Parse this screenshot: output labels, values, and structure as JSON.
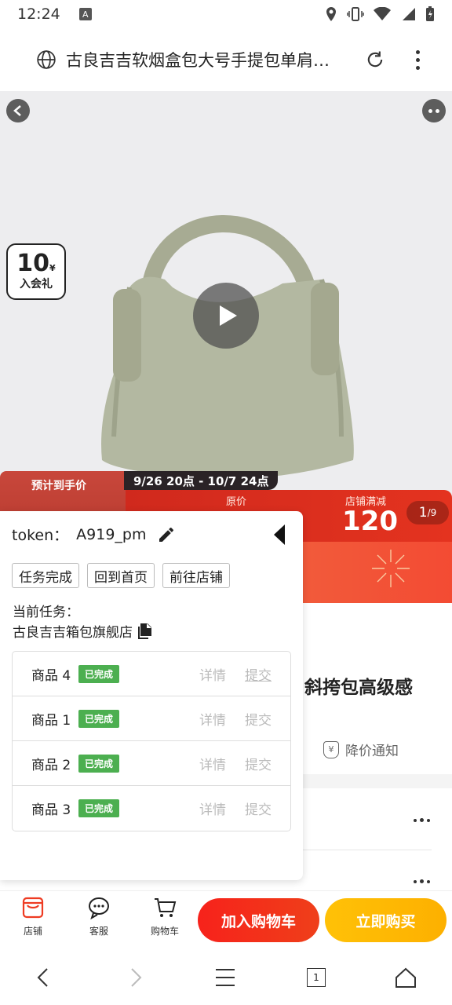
{
  "status_bar": {
    "time": "12:24",
    "notif_letter": "A"
  },
  "url_bar": {
    "title": "古良吉吉软烟盒包大号手提包单肩…"
  },
  "product": {
    "badge_value": "10",
    "badge_currency": "¥",
    "badge_text": "入会礼"
  },
  "promo": {
    "estimate_label": "预计到手价",
    "date_range": "9/26 20点 - 10/7 24点",
    "orig_label": "原价",
    "shop_discount_label": "店铺满减",
    "shop_discount_value": "120",
    "page_current": "1",
    "page_total": "/9"
  },
  "product_info": {
    "name_tail": "斜挎包高级感",
    "price_notice": "降价通知",
    "price_notice_icon": "¥"
  },
  "panel": {
    "token_label": "token：",
    "token_value": "A919_pm",
    "buttons": [
      "任务完成",
      "回到首页",
      "前往店铺"
    ],
    "current_task_label": "当前任务：",
    "current_store": "古良吉吉箱包旗舰店",
    "tasks": [
      {
        "name": "商品 4",
        "status": "已完成",
        "detail": "详情",
        "submit": "提交"
      },
      {
        "name": "商品 1",
        "status": "已完成",
        "detail": "详情",
        "submit": "提交"
      },
      {
        "name": "商品 2",
        "status": "已完成",
        "detail": "详情",
        "submit": "提交"
      },
      {
        "name": "商品 3",
        "status": "已完成",
        "detail": "详情",
        "submit": "提交"
      }
    ]
  },
  "bottom_bar": {
    "store": "店铺",
    "service": "客服",
    "cart": "购物车",
    "add_to_cart": "加入购物车",
    "buy_now": "立即购买"
  },
  "nav": {
    "tabs_count": "1"
  },
  "colors": {
    "accent_red": "#f7221b",
    "accent_yellow": "#ffc107",
    "status_green": "#4caf50"
  }
}
